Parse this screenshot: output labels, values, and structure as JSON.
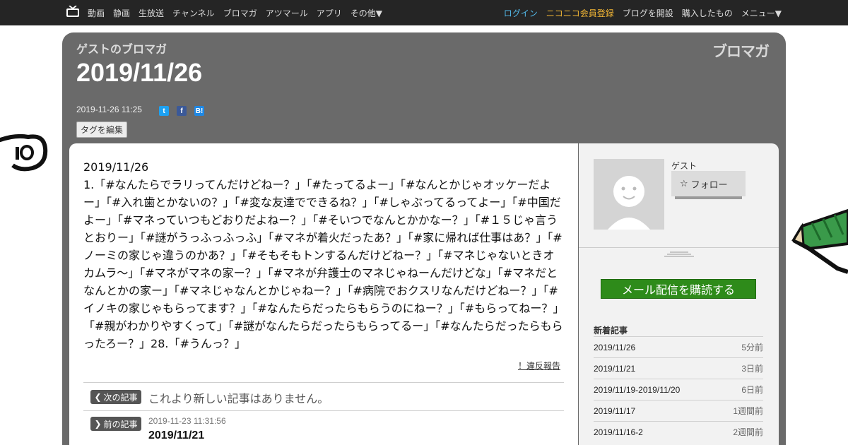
{
  "nav": {
    "left_items": [
      "動画",
      "静画",
      "生放送",
      "チャンネル",
      "ブロマガ",
      "アツマール",
      "アプリ",
      "その他▼"
    ],
    "login": "ログイン",
    "register": "ニコニコ会員登録",
    "open_blog": "ブログを開設",
    "purchased": "購入したもの",
    "menu": "メニュー▼"
  },
  "header": {
    "blog_name": "ゲストのブロマガ",
    "title": "2019/11/26",
    "logo_text": "ブロマガ",
    "post_datetime": "2019-11-26 11:25",
    "share_icons": [
      "twitter-icon",
      "facebook-icon",
      "hatena-bookmark-icon"
    ],
    "tag_edit_label": "タグを編集"
  },
  "article": {
    "first_line": "2019/11/26",
    "body": "1.「#なんたらでラリってんだけどねー？」「#たってるよー」「#なんとかじゃオッケーだよー」「#入れ歯とかないの？」「#変な友達でできるね？」「#しゃぶってるってよー」「#中国だよー」「#マネっていつもどおりだよねー？」「#そいつでなんとかかなー？」「#１５じゃ言うとおりー」「#謎がうっふっふっふ」「#マネが着火だったあ？」「#家に帰れば仕事はあ？」「#ノーミの家じゃ違うのかあ？」「#そもそもトンするんだけどねー？」「#マネじゃないときオカムラ〜」「#マネがマネの家ー？」「#マネが弁護士のマネじゃねーんだけどな」「#マネだとなんとかの家ー」「#マネじゃなんとかじゃねー？」「#病院でおクスリなんだけどねー？」「#イノキの家じゃもらってます？」「#なんたらだったらもらうのにねー？」「#もらってねー？」「#親がわかりやすくって」「#謎がなんたらだったらもらってるー」「#なんたらだったらもらったろー？」28.「#うんっ？」",
    "report_link": "！違反報告"
  },
  "article_nav": {
    "next_label": "次の記事",
    "next_text": "これより新しい記事はありません。",
    "prev_label": "前の記事",
    "prev_datetime": "2019-11-23 11:31:56",
    "prev_title": "2019/11/21"
  },
  "sidebar": {
    "username": "ゲスト",
    "follow_label": "フォロー",
    "subscribe_label": "メール配信を購読する",
    "recent_heading": "新着記事",
    "recent": [
      {
        "title": "2019/11/26",
        "ago": "5分前"
      },
      {
        "title": "2019/11/21",
        "ago": "3日前"
      },
      {
        "title": "2019/11/19-2019/11/20",
        "ago": "6日前"
      },
      {
        "title": "2019/11/17",
        "ago": "1週間前"
      },
      {
        "title": "2019/11/16-2",
        "ago": "2週間前"
      }
    ]
  },
  "colors": {
    "topbar": "#252525",
    "panel": "#6a6a6a",
    "login": "#52b8e8",
    "register": "#f2b635",
    "subscribe": "#2e8b1a"
  }
}
